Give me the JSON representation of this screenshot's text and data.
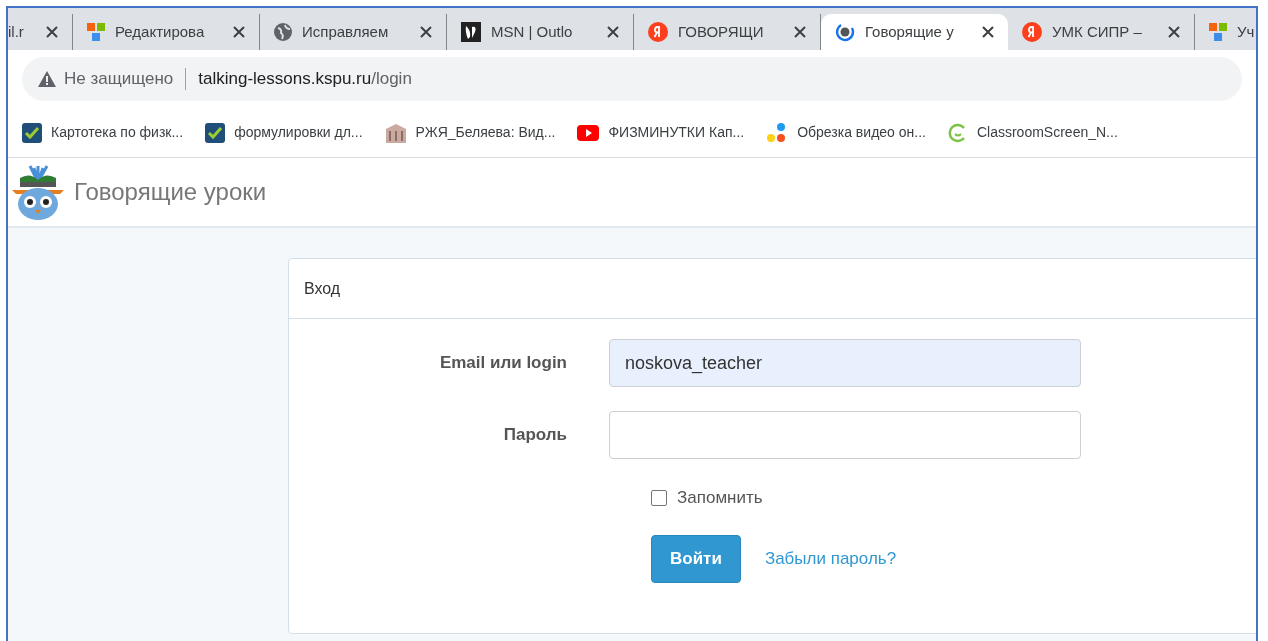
{
  "tabs": [
    {
      "title": "il.r",
      "kind": "none",
      "selected": false
    },
    {
      "title": "Редактирова",
      "kind": "tiles",
      "selected": false
    },
    {
      "title": "Исправляем",
      "kind": "globe",
      "selected": false
    },
    {
      "title": "MSN | Outlo",
      "kind": "msn",
      "selected": false
    },
    {
      "title": "ГОВОРЯЩИ",
      "kind": "yandex",
      "selected": false
    },
    {
      "title": "Говорящие у",
      "kind": "site",
      "selected": true
    },
    {
      "title": "УМК СИПР –",
      "kind": "yandex",
      "selected": false
    },
    {
      "title": "Уч",
      "kind": "tiles",
      "selected": false
    }
  ],
  "address_bar": {
    "security": "Не защищено",
    "url_host": "talking-lessons.kspu.ru",
    "url_path": "/login"
  },
  "bookmarks": [
    {
      "title": "Картотека по физк...",
      "kind": "check"
    },
    {
      "title": "формулировки дл...",
      "kind": "check"
    },
    {
      "title": "РЖЯ_Беляева: Вид...",
      "kind": "building"
    },
    {
      "title": "ФИЗМИНУТКИ Кап...",
      "kind": "youtube"
    },
    {
      "title": "Обрезка видео он...",
      "kind": "dots"
    },
    {
      "title": "ClassroomScreen_N...",
      "kind": "classroom"
    }
  ],
  "site": {
    "brand": "Говорящие уроки"
  },
  "login_card": {
    "title": "Вход",
    "fields": [
      {
        "label": "Email или login",
        "value": "noskova_teacher",
        "autofilled": true,
        "kind": "text"
      },
      {
        "label": "Пароль",
        "autofilled": false,
        "kind": "password"
      }
    ],
    "remember": {
      "label": "Запомнить",
      "checked": false
    },
    "submit": "Войти",
    "forgot_link": "Забыли пароль?"
  }
}
